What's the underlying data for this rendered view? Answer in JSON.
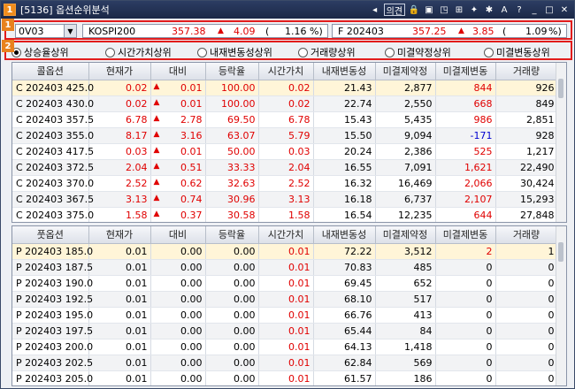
{
  "window": {
    "number": "1",
    "title": "[5136] 옵션순위분석",
    "tools": [
      "◂",
      "의견",
      "🔒",
      "▣",
      "◳",
      "⊞",
      "✦",
      "✱",
      "A",
      "?",
      "_",
      "□",
      "✕"
    ]
  },
  "markers": {
    "m1": "1",
    "m2": "2"
  },
  "bar1": {
    "combo_value": "0V03",
    "quote1": {
      "name": "KOSPI200",
      "price": "357.38",
      "arrow": "▲",
      "change": "4.09",
      "pct_open": "(",
      "pct": "1.16",
      "pct_unit": "%)"
    },
    "quote2": {
      "name": "F 202403",
      "price": "357.25",
      "arrow": "▲",
      "change": "3.85",
      "pct_open": "(",
      "pct": "1.09",
      "pct_unit": "%)"
    }
  },
  "radios": [
    {
      "label": "상승율상위",
      "selected": true
    },
    {
      "label": "시간가치상위",
      "selected": false
    },
    {
      "label": "내재변동성상위",
      "selected": false
    },
    {
      "label": "거래량상위",
      "selected": false
    },
    {
      "label": "미결약정상위",
      "selected": false
    },
    {
      "label": "미결변동상위",
      "selected": false
    }
  ],
  "call_table": {
    "headers": [
      "콜옵션",
      "현재가",
      "대비",
      "등락율",
      "시간가치",
      "내재변동성",
      "미결제약정",
      "미결제변동",
      "거래량"
    ],
    "rows": [
      [
        "C 202403 425.0",
        "0.02",
        "▲",
        "0.01",
        "100.00",
        "0.02",
        "21.43",
        "2,877",
        "844",
        "926"
      ],
      [
        "C 202403 430.0",
        "0.02",
        "▲",
        "0.01",
        "100.00",
        "0.02",
        "22.74",
        "2,550",
        "668",
        "849"
      ],
      [
        "C 202403 357.5",
        "6.78",
        "▲",
        "2.78",
        "69.50",
        "6.78",
        "15.43",
        "5,435",
        "986",
        "2,851"
      ],
      [
        "C 202403 355.0",
        "8.17",
        "▲",
        "3.16",
        "63.07",
        "5.79",
        "15.50",
        "9,094",
        "-171",
        "928"
      ],
      [
        "C 202403 417.5",
        "0.03",
        "▲",
        "0.01",
        "50.00",
        "0.03",
        "20.24",
        "2,386",
        "525",
        "1,217"
      ],
      [
        "C 202403 372.5",
        "2.04",
        "▲",
        "0.51",
        "33.33",
        "2.04",
        "16.55",
        "7,091",
        "1,621",
        "22,490"
      ],
      [
        "C 202403 370.0",
        "2.52",
        "▲",
        "0.62",
        "32.63",
        "2.52",
        "16.32",
        "16,469",
        "2,066",
        "30,424"
      ],
      [
        "C 202403 367.5",
        "3.13",
        "▲",
        "0.74",
        "30.96",
        "3.13",
        "16.18",
        "6,737",
        "2,107",
        "15,293"
      ],
      [
        "C 202403 375.0",
        "1.58",
        "▲",
        "0.37",
        "30.58",
        "1.58",
        "16.54",
        "12,235",
        "644",
        "27,848"
      ]
    ]
  },
  "put_table": {
    "headers": [
      "풋옵션",
      "현재가",
      "대비",
      "등락율",
      "시간가치",
      "내재변동성",
      "미결제약정",
      "미결제변동",
      "거래량"
    ],
    "rows": [
      [
        "P 202403 185.0",
        "0.01",
        "",
        "0.00",
        "0.00",
        "0.01",
        "72.22",
        "3,512",
        "2",
        "1"
      ],
      [
        "P 202403 187.5",
        "0.01",
        "",
        "0.00",
        "0.00",
        "0.01",
        "70.83",
        "485",
        "0",
        "0"
      ],
      [
        "P 202403 190.0",
        "0.01",
        "",
        "0.00",
        "0.00",
        "0.01",
        "69.45",
        "652",
        "0",
        "0"
      ],
      [
        "P 202403 192.5",
        "0.01",
        "",
        "0.00",
        "0.00",
        "0.01",
        "68.10",
        "517",
        "0",
        "0"
      ],
      [
        "P 202403 195.0",
        "0.01",
        "",
        "0.00",
        "0.00",
        "0.01",
        "66.76",
        "413",
        "0",
        "0"
      ],
      [
        "P 202403 197.5",
        "0.01",
        "",
        "0.00",
        "0.00",
        "0.01",
        "65.44",
        "84",
        "0",
        "0"
      ],
      [
        "P 202403 200.0",
        "0.01",
        "",
        "0.00",
        "0.00",
        "0.01",
        "64.13",
        "1,418",
        "0",
        "0"
      ],
      [
        "P 202403 202.5",
        "0.01",
        "",
        "0.00",
        "0.00",
        "0.01",
        "62.84",
        "569",
        "0",
        "0"
      ],
      [
        "P 202403 205.0",
        "0.01",
        "",
        "0.00",
        "0.00",
        "0.01",
        "61.57",
        "186",
        "0",
        "0"
      ]
    ]
  },
  "colors": {
    "up": "#e00000",
    "down": "#0000d0",
    "highlight": "#fff5d8",
    "title_bg": "#1b2847",
    "marker_border": "#e21c1c"
  }
}
